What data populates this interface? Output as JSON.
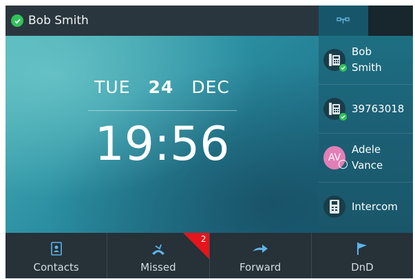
{
  "header": {
    "user_name": "Bob Smith"
  },
  "clock": {
    "weekday": "TUE",
    "day": "24",
    "month": "DEC",
    "time": "19:56"
  },
  "line_keys": [
    {
      "label_line1": "Bob",
      "label_line2": "Smith",
      "icon": "desk-phone-icon",
      "status": "registered"
    },
    {
      "label_line1": "39763018",
      "label_line2": "",
      "icon": "desk-phone-icon",
      "status": "registered"
    },
    {
      "label_line1": "Adele",
      "label_line2": "Vance",
      "icon": "avatar",
      "avatar_initials": "AV",
      "status": "away"
    },
    {
      "label_line1": "Intercom",
      "label_line2": "",
      "icon": "intercom-phone-icon",
      "status": ""
    }
  ],
  "softkeys": [
    {
      "label": "Contacts",
      "icon": "contacts-icon"
    },
    {
      "label": "Missed",
      "icon": "missed-call-icon",
      "badge": "2"
    },
    {
      "label": "Forward",
      "icon": "forward-icon"
    },
    {
      "label": "DnD",
      "icon": "dnd-flag-icon"
    }
  ],
  "colors": {
    "status_ok": "#32c25a",
    "missed_badge": "#e5151b",
    "avatar_bg": "#e27fb6",
    "accent": "#17566a"
  }
}
